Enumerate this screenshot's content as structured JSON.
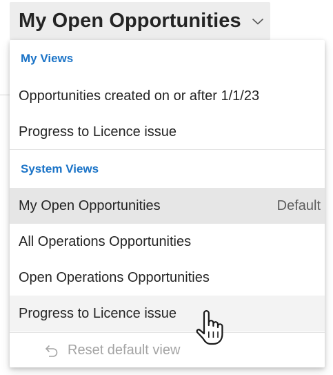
{
  "header": {
    "title": "My Open Opportunities",
    "chevron_icon": "chevron-down-icon"
  },
  "dropdown": {
    "my_views": {
      "header": "My Views",
      "items": [
        {
          "label": "Opportunities created on or after 1/1/23"
        },
        {
          "label": "Progress to Licence issue"
        }
      ]
    },
    "system_views": {
      "header": "System Views",
      "items": [
        {
          "label": "My Open Opportunities",
          "badge": "Default",
          "state": "selected"
        },
        {
          "label": "All Operations Opportunities"
        },
        {
          "label": "Open Operations Opportunities"
        },
        {
          "label": "Progress to Licence issue",
          "state": "hovered"
        }
      ]
    },
    "reset": {
      "label": "Reset default view",
      "icon": "undo-icon",
      "disabled": true
    }
  },
  "cursor": {
    "icon": "hand-pointer-icon"
  },
  "colors": {
    "section_header": "#1a73c7",
    "selected_bg": "#e6e6e6",
    "hover_bg": "#f3f3f3",
    "header_bg": "#ededed",
    "disabled_text": "#a4a4a4"
  }
}
